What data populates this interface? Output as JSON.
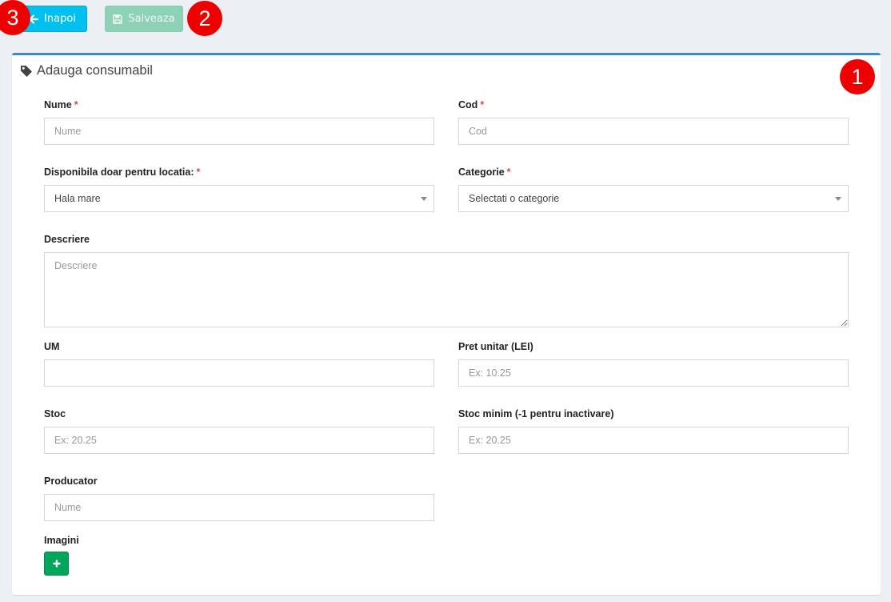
{
  "toolbar": {
    "back_label": "Inapoi",
    "save_label": "Salveaza"
  },
  "badges": [
    "3",
    "2",
    "1"
  ],
  "form": {
    "title": "Adauga consumabil",
    "required_marker": "*",
    "nume": {
      "label": "Nume",
      "placeholder": "Nume",
      "value": ""
    },
    "cod": {
      "label": "Cod",
      "placeholder": "Cod",
      "value": ""
    },
    "locatie": {
      "label": "Disponibila doar pentru locatia:",
      "selected": "Hala mare"
    },
    "categorie": {
      "label": "Categorie",
      "selected": "Selectati o categorie"
    },
    "descriere": {
      "label": "Descriere",
      "placeholder": "Descriere",
      "value": ""
    },
    "um": {
      "label": "UM",
      "placeholder": "",
      "value": ""
    },
    "pret": {
      "label": "Pret unitar (LEI)",
      "placeholder": "Ex: 10.25",
      "value": ""
    },
    "stoc": {
      "label": "Stoc",
      "placeholder": "Ex: 20.25",
      "value": ""
    },
    "stoc_minim": {
      "label": "Stoc minim (-1 pentru inactivare)",
      "placeholder": "Ex: 20.25",
      "value": ""
    },
    "producator": {
      "label": "Producator",
      "placeholder": "Nume",
      "value": ""
    },
    "imagini": {
      "label": "Imagini"
    }
  },
  "icons": {
    "back": "arrow-left-icon",
    "save": "floppy-disk-icon",
    "title": "tag-icon",
    "add": "plus-icon"
  },
  "colors": {
    "info": "#00c0ef",
    "success": "#00a65a",
    "primary": "#3c8dbc",
    "badge": "#ee0000",
    "required": "#dd4b39",
    "background": "#ecf0f5"
  }
}
